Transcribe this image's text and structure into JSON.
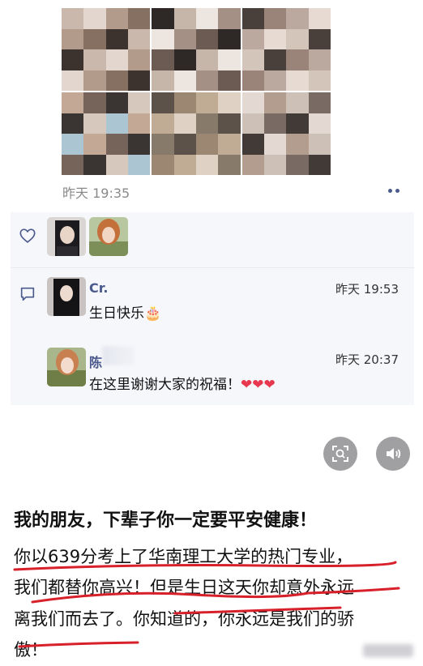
{
  "post": {
    "time": "昨天 19:35"
  },
  "likes": {
    "count_avatars": 2
  },
  "comments": [
    {
      "name": "Cr.",
      "time": "昨天 19:53",
      "text": "生日快乐",
      "emoji": "🎂"
    },
    {
      "name": "陈",
      "time": "昨天 20:37",
      "text": "在这里谢谢大家的祝福！",
      "emoji": "❤❤❤"
    }
  ],
  "article": {
    "headline": "我的朋友，下辈子你一定要平安健康！",
    "lines": [
      "你以639分考上了华南理工大学的热门专业，",
      "我们都替你高兴！但是生日这天你却意外永远",
      "离我们而去了。你知道的，你永远是我们的骄",
      "傲！"
    ]
  },
  "colors": {
    "name_blue": "#4a5a8c",
    "underline_red": "#d8202a",
    "heart_red": "#e8384f"
  },
  "icons": [
    "heart-icon",
    "comment-icon",
    "scan-icon",
    "speaker-icon",
    "more-icon",
    "birthday-cake-emoji"
  ]
}
